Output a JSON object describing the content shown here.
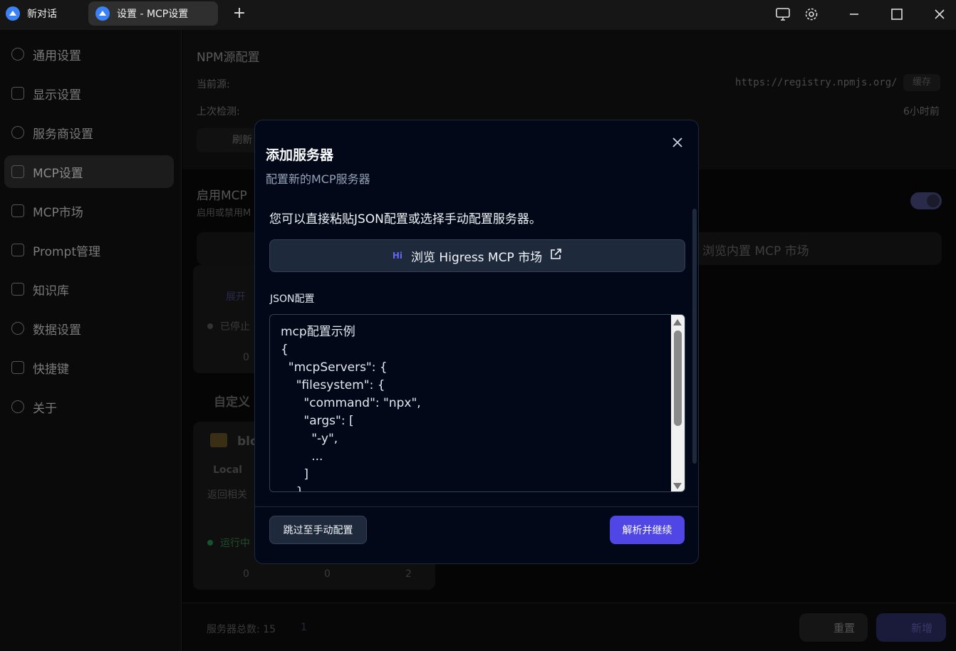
{
  "titlebar": {
    "tab1_label": "新对话",
    "tab2_label": "设置 - MCP设置",
    "new_tab_symbol": "+"
  },
  "sidebar": {
    "items": [
      {
        "label": "通用设置"
      },
      {
        "label": "显示设置"
      },
      {
        "label": "服务商设置"
      },
      {
        "label": "MCP设置"
      },
      {
        "label": "MCP市场"
      },
      {
        "label": "Prompt管理"
      },
      {
        "label": "知识库"
      },
      {
        "label": "数据设置"
      },
      {
        "label": "快捷键"
      },
      {
        "label": "关于"
      }
    ]
  },
  "background": {
    "npm_title": "NPM源配置",
    "current_source_label": "当前源:",
    "current_source_value": "https://registry.npmjs.org/",
    "cache_label": "缓存",
    "last_check_label": "上次检测:",
    "last_check_value": "6小时前",
    "refresh_label": "刷新",
    "enable_mcp_title": "启用MCP",
    "enable_mcp_desc": "启用或禁用M",
    "browse_builtin_label": "浏览内置 MCP 市场",
    "expand_label": "展开",
    "stopped_label": "已停止",
    "tools_count_1": "0",
    "custom_section_title": "自定义",
    "card_name": "blo",
    "local_badge": "Local",
    "card_desc": "返回相关",
    "running_label": "运行中",
    "tools_count_2": "0",
    "prompts_count": "0",
    "resources_count": "2",
    "server_total": "服务器总数: 15",
    "running_count": "1",
    "reset_label": "重置",
    "add_label": "新增"
  },
  "modal": {
    "title": "添加服务器",
    "subtitle": "配置新的MCP服务器",
    "intro": "您可以直接粘贴JSON配置或选择手动配置服务器。",
    "market_button": "浏览 Higress MCP 市场",
    "market_logo_text": "Hi",
    "json_label": "JSON配置",
    "json_placeholder": "mcp配置示例\n{\n  \"mcpServers\": {\n    \"filesystem\": {\n      \"command\": \"npx\",\n      \"args\": [\n        \"-y\",\n        ...\n      ]\n    }",
    "skip_button": "跳过至手动配置",
    "parse_button": "解析并继续"
  },
  "colors": {
    "accent": "#4f46e5",
    "modal_bg": "#020817",
    "border": "#334155"
  }
}
